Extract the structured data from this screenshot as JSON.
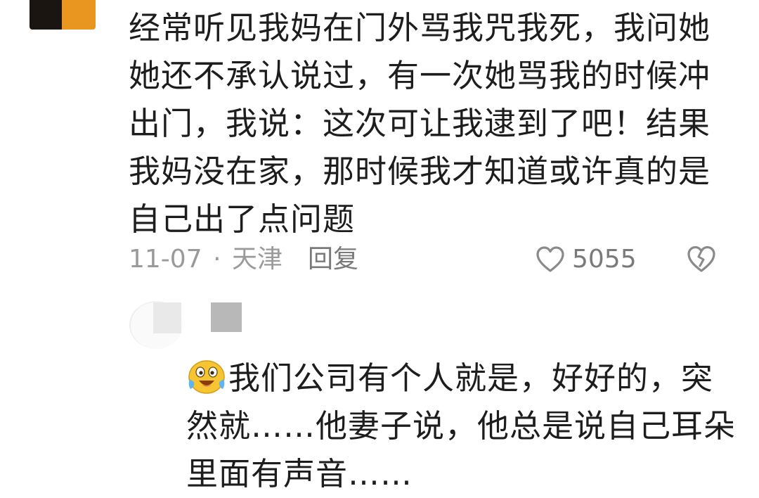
{
  "comment": {
    "avatar_colors": [
      "#1a1511",
      "#e89620"
    ],
    "lines": [
      "经常听见我妈在门外骂我咒我死，我问她",
      "她还不承认说过，有一次她骂我的时候冲",
      "出门，我说：这次可让我逮到了吧！结果",
      "我妈没在家，那时候我才知道或许真的是",
      "自己出了点问题"
    ],
    "date": "11-07",
    "separator": "·",
    "location": "天津",
    "reply_label": "回复",
    "like_icon": "heart-outline-icon",
    "like_count": "5055",
    "dislike_icon": "broken-heart-icon"
  },
  "reply": {
    "emoji": "laughing-crying-emoji",
    "lines": [
      "我们公司有个人就是，好好的，突",
      "然就……他妻子说，他总是说自己耳朵",
      "里面有声音……"
    ]
  }
}
